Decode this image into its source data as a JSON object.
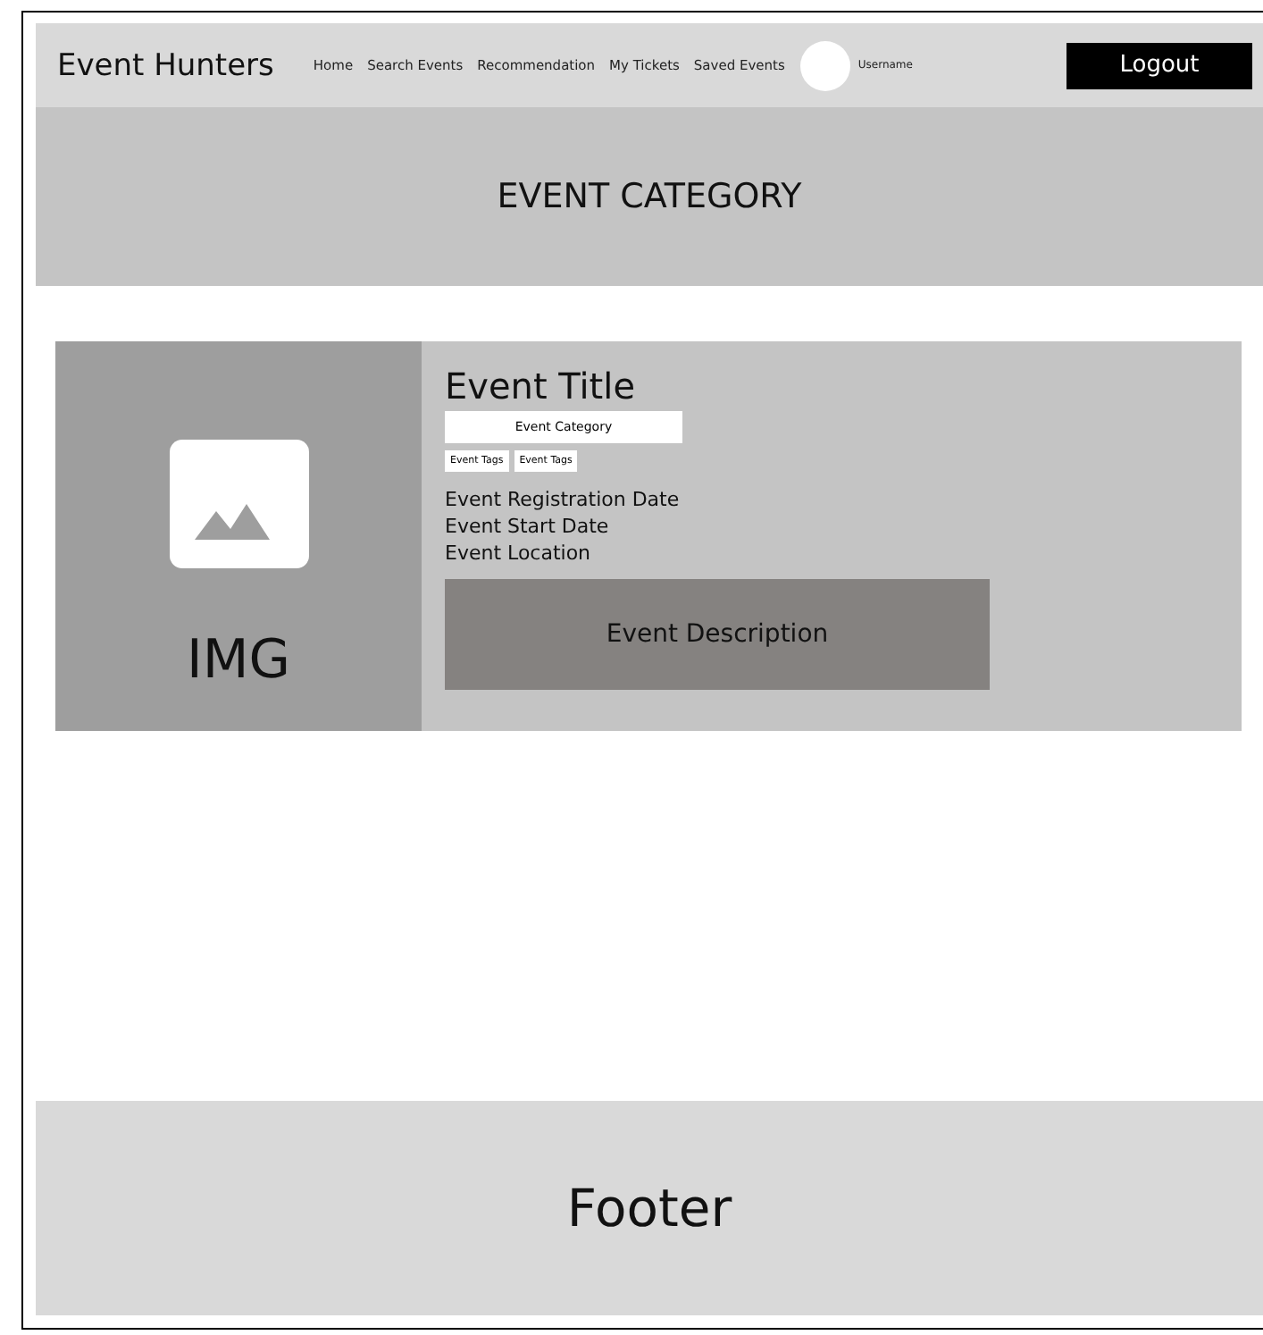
{
  "header": {
    "brand": "Event Hunters",
    "nav": [
      {
        "label": "Home"
      },
      {
        "label": "Search Events"
      },
      {
        "label": "Recommendation"
      },
      {
        "label": "My Tickets"
      },
      {
        "label": "Saved Events"
      }
    ],
    "username": "Username",
    "logout": "Logout"
  },
  "hero": {
    "title": "EVENT CATEGORY"
  },
  "event": {
    "image_label": "IMG",
    "title": "Event Title",
    "category": "Event Category",
    "tags": [
      "Event Tags",
      "Event Tags"
    ],
    "details": [
      "Event Registration Date",
      "Event Start Date",
      "Event Location"
    ],
    "description": "Event Description"
  },
  "footer": {
    "text": "Footer"
  }
}
